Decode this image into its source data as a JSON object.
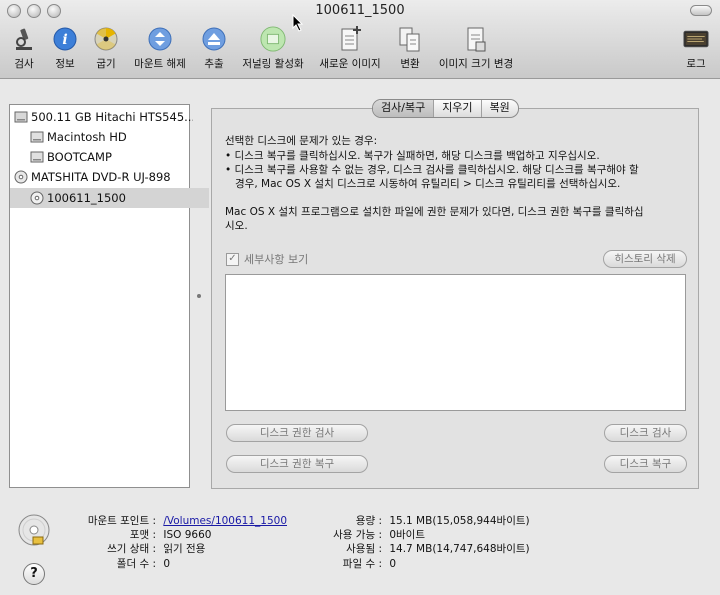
{
  "window": {
    "title": "100611_1500"
  },
  "toolbar": {
    "items": [
      {
        "label": "검사",
        "icon": "microscope-icon"
      },
      {
        "label": "정보",
        "icon": "info-icon"
      },
      {
        "label": "굽기",
        "icon": "burn-icon"
      },
      {
        "label": "마운트 해제",
        "icon": "unmount-icon"
      },
      {
        "label": "추출",
        "icon": "eject-icon"
      },
      {
        "label": "저널링 활성화",
        "icon": "journaling-icon"
      },
      {
        "label": "새로운 이미지",
        "icon": "new-image-icon"
      },
      {
        "label": "변환",
        "icon": "convert-icon"
      },
      {
        "label": "이미지 크기 변경",
        "icon": "resize-image-icon"
      },
      {
        "label": "로그",
        "icon": "log-icon"
      }
    ]
  },
  "sidebar": {
    "items": [
      {
        "label": "500.11 GB Hitachi HTS545..."
      },
      {
        "label": "Macintosh HD"
      },
      {
        "label": "BOOTCAMP"
      },
      {
        "label": "MATSHITA DVD-R UJ-898"
      },
      {
        "label": "100611_1500"
      }
    ]
  },
  "tabs": [
    "검사/복구",
    "지우기",
    "복원"
  ],
  "instructions": {
    "line1": "선택한 디스크에 문제가 있는 경우:",
    "line2": "• 디스크 복구를 클릭하십시오. 복구가 실패하면, 해당 디스크를 백업하고 지우십시오.",
    "line3": "• 디스크 복구를 사용할 수 없는 경우, 디스크 검사를 클릭하십시오. 해당 디스크를 복구해야 할",
    "line4": "   경우, Mac OS X 설치 디스크로 시동하여 유틸리티 > 디스크 유틸리티를 선택하십시오.",
    "line5": "Mac OS X 설치 프로그램으로 설치한 파일에 권한 문제가 있다면, 디스크 권한 복구를 클릭하십",
    "line6": "시오."
  },
  "details": {
    "checkbox_label": "세부사항 보기",
    "checked": true
  },
  "buttons": {
    "clear_history": "히스토리 삭제",
    "verify_permissions": "디스크 권한 검사",
    "repair_permissions": "디스크 권한 복구",
    "verify_disk": "디스크 검사",
    "repair_disk": "디스크 복구"
  },
  "info": {
    "mount_point_label": "마운트 포인트 :",
    "mount_point_value": "/Volumes/100611_1500",
    "format_label": "포맷 :",
    "format_value": "ISO 9660",
    "write_status_label": "쓰기 상태 :",
    "write_status_value": "읽기 전용",
    "folders_label": "폴더 수 :",
    "folders_value": "0",
    "capacity_label": "용량 :",
    "capacity_value": "15.1 MB(15,058,944바이트)",
    "available_label": "사용 가능 :",
    "available_value": "0바이트",
    "used_label": "사용됨 :",
    "used_value": "14.7 MB(14,747,648바이트)",
    "files_label": "파일 수 :",
    "files_value": "0"
  },
  "help": {
    "glyph": "?"
  }
}
